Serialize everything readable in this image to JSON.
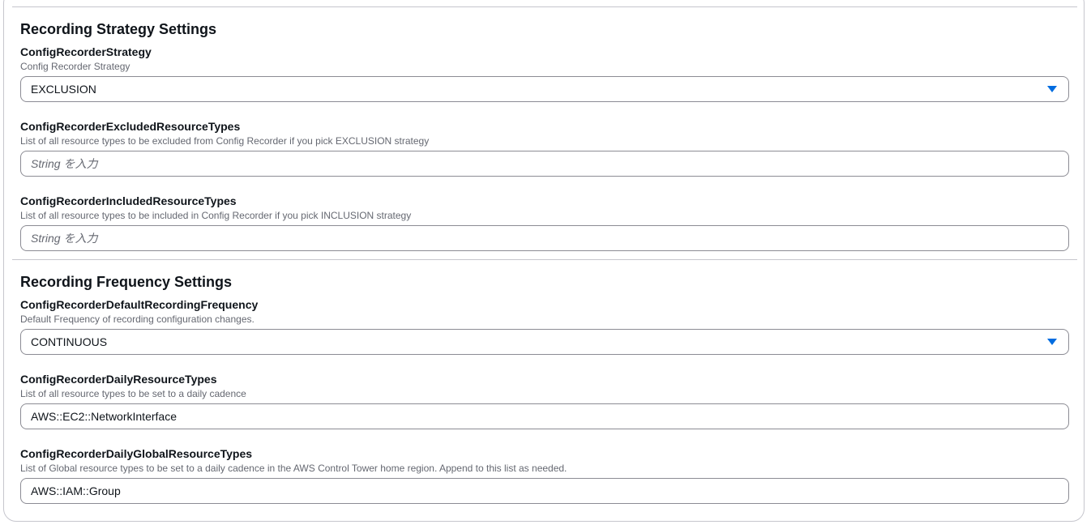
{
  "strategy_section": {
    "title": "Recording Strategy Settings",
    "fields": [
      {
        "label": "ConfigRecorderStrategy",
        "description": "Config Recorder Strategy",
        "selected": "EXCLUSION"
      },
      {
        "label": "ConfigRecorderExcludedResourceTypes",
        "description": "List of all resource types to be excluded from Config Recorder if you pick EXCLUSION strategy",
        "value": "",
        "placeholder": "String を入力"
      },
      {
        "label": "ConfigRecorderIncludedResourceTypes",
        "description": "List of all resource types to be included in Config Recorder if you pick INCLUSION strategy",
        "value": "",
        "placeholder": "String を入力"
      }
    ]
  },
  "frequency_section": {
    "title": "Recording Frequency Settings",
    "fields": [
      {
        "label": "ConfigRecorderDefaultRecordingFrequency",
        "description": "Default Frequency of recording configuration changes.",
        "selected": "CONTINUOUS"
      },
      {
        "label": "ConfigRecorderDailyResourceTypes",
        "description": "List of all resource types to be set to a daily cadence",
        "value": "AWS::EC2::NetworkInterface"
      },
      {
        "label": "ConfigRecorderDailyGlobalResourceTypes",
        "description": "List of Global resource types to be set to a daily cadence in the AWS Control Tower home region. Append to this list as needed.",
        "value": "AWS::IAM::Group"
      }
    ]
  },
  "colors": {
    "accent": "#006ce0",
    "border": "#8c8c94",
    "divider": "#c6c6cd",
    "text": "#0f141a",
    "secondary_text": "#656871"
  },
  "icons": {
    "dropdown": "caret-down-icon"
  }
}
